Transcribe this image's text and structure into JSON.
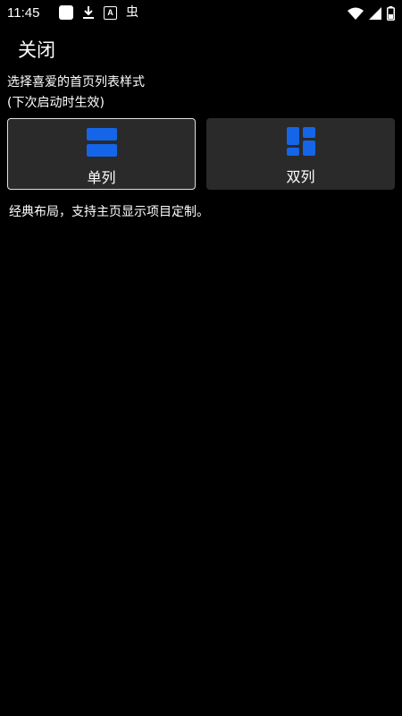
{
  "status_bar": {
    "time": "11:45",
    "left_icons": [
      "app-square-icon",
      "download-icon",
      "a-icon",
      "bug-icon"
    ],
    "right_icons": [
      "wifi-icon",
      "signal-icon",
      "battery-icon"
    ],
    "a_glyph": "A",
    "bug_glyph": "虫"
  },
  "header": {
    "close_label": "关闭"
  },
  "prompt": {
    "title": "选择喜爱的首页列表样式",
    "subtitle": "(下次启动时生效)"
  },
  "options": {
    "single_label": "单列",
    "double_label": "双列",
    "selected": "单列"
  },
  "description": "经典布局，支持主页显示项目定制。",
  "colors": {
    "accent": "#1565e8",
    "background": "#000000",
    "card": "#2a2a2a"
  }
}
